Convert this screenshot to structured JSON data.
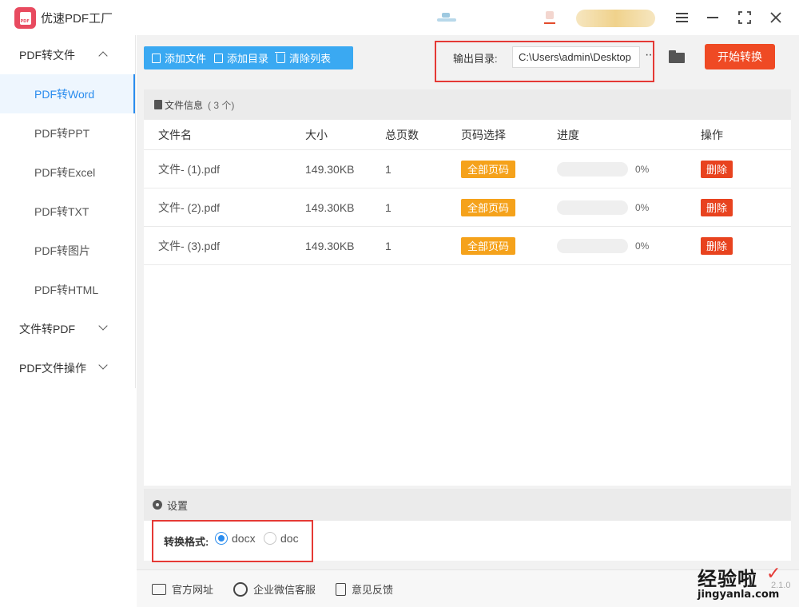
{
  "window": {
    "title": "优速PDF工厂"
  },
  "sidebar": {
    "groups": [
      {
        "label": "PDF转文件",
        "expanded": true,
        "items": [
          "PDF转Word",
          "PDF转PPT",
          "PDF转Excel",
          "PDF转TXT",
          "PDF转图片",
          "PDF转HTML"
        ]
      },
      {
        "label": "文件转PDF",
        "expanded": false
      },
      {
        "label": "PDF文件操作",
        "expanded": false
      }
    ],
    "active_item": "PDF转Word"
  },
  "toolbar": {
    "add_file": "添加文件",
    "add_folder": "添加目录",
    "clear_list": "清除列表",
    "output_label": "输出目录:",
    "output_path": "C:\\Users\\admin\\Desktop",
    "more": "···",
    "start": "开始转换"
  },
  "file_list": {
    "header": "文件信息",
    "count": "( 3 个)",
    "columns": [
      "文件名",
      "大小",
      "总页数",
      "页码选择",
      "进度",
      "操作"
    ],
    "rows": [
      {
        "name": "文件- (1).pdf",
        "size": "149.30KB",
        "pages": "1",
        "range": "全部页码",
        "progress": 0,
        "progress_label": "0%",
        "action": "删除"
      },
      {
        "name": "文件- (2).pdf",
        "size": "149.30KB",
        "pages": "1",
        "range": "全部页码",
        "progress": 0,
        "progress_label": "0%",
        "action": "删除"
      },
      {
        "name": "文件- (3).pdf",
        "size": "149.30KB",
        "pages": "1",
        "range": "全部页码",
        "progress": 0,
        "progress_label": "0%",
        "action": "删除"
      }
    ]
  },
  "settings": {
    "header": "设置",
    "format_label": "转换格式:",
    "options": [
      {
        "label": "docx",
        "checked": true
      },
      {
        "label": "doc",
        "checked": false
      }
    ]
  },
  "footer": {
    "website": "官方网址",
    "wechat": "企业微信客服",
    "feedback": "意见反馈",
    "version": "2.1.0"
  },
  "watermark": {
    "text": "经验啦",
    "check": "✓",
    "url": "jingyanla.com"
  },
  "colors": {
    "accent_blue": "#3aa9f2",
    "active_blue": "#2a8cee",
    "start_orange": "#ef4a24",
    "range_orange": "#f5a21b",
    "delete_red": "#e8431f",
    "highlight_red": "#e53935"
  }
}
